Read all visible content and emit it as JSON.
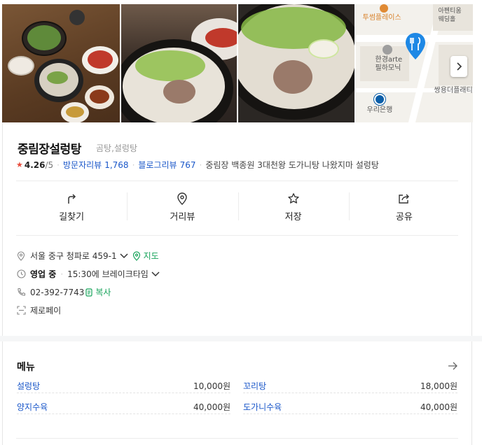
{
  "map": {
    "labels": {
      "top_right": "아펜티움\n웨딩홀",
      "twosome": "투썸플레이스",
      "hall": "한경arte\n필하모닉",
      "ssangyong": "쌍용더플래티",
      "bank": "우리은행"
    }
  },
  "place": {
    "name": "중림장설렁탕",
    "category": "곰탕,설렁탕",
    "rating": "4.26",
    "rating_max": "/5",
    "visitor_review_label": "방문자리뷰",
    "visitor_review_count": "1,768",
    "blog_review_label": "블로그리뷰",
    "blog_review_count": "767",
    "description": "중림장 백종원 3대천왕 도가니탕 나왔지마 설렁탕"
  },
  "actions": [
    {
      "label": "길찾기",
      "icon": "directions-icon"
    },
    {
      "label": "거리뷰",
      "icon": "location-pin-icon"
    },
    {
      "label": "저장",
      "icon": "star-icon"
    },
    {
      "label": "공유",
      "icon": "share-icon"
    }
  ],
  "info": {
    "address": "서울 중구 청파로 459-1",
    "map_link": "지도",
    "status": "영업 중",
    "hours": "15:30에 브레이크타임",
    "phone": "02-392-7743",
    "copy": "복사",
    "payment": "제로페이"
  },
  "menu": {
    "title": "메뉴",
    "items": [
      {
        "name": "설렁탕",
        "price": "10,000원"
      },
      {
        "name": "꼬리탕",
        "price": "18,000원"
      },
      {
        "name": "양지수육",
        "price": "40,000원"
      },
      {
        "name": "도가니수육",
        "price": "40,000원"
      }
    ]
  },
  "colors": {
    "link_blue": "#1a57c9",
    "map_pin": "#1e88e5",
    "status_green": "#16a35a",
    "star_red": "#e84d3d"
  }
}
